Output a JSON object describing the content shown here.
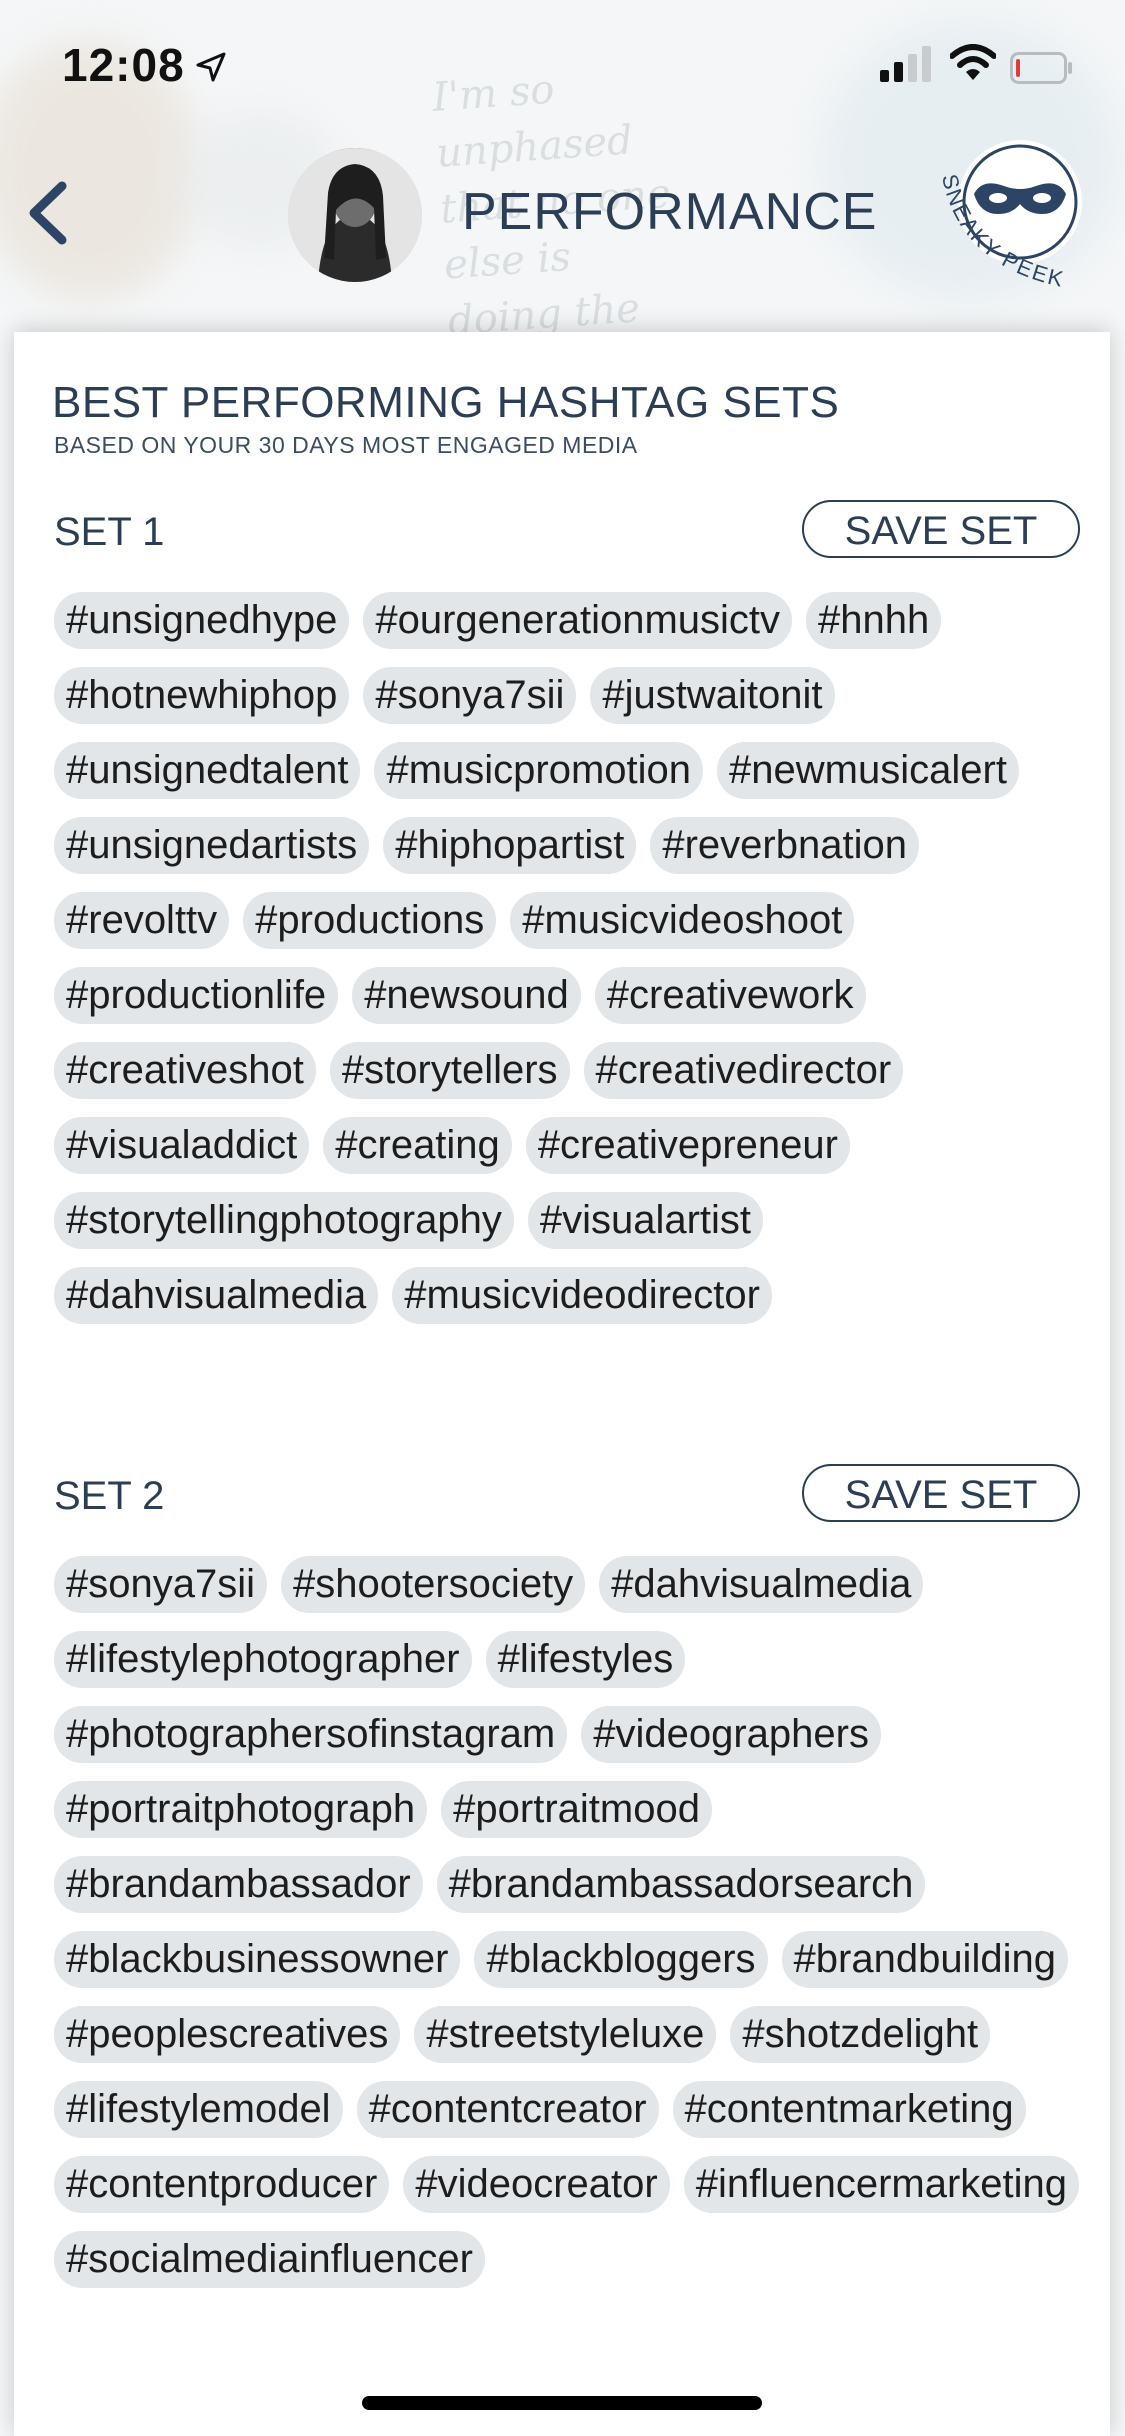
{
  "status_bar": {
    "time": "12:08"
  },
  "header": {
    "title": "PERFORMANCE"
  },
  "card": {
    "title": "BEST PERFORMING HASHTAG SETS",
    "subtitle": "BASED ON YOUR 30 DAYS MOST ENGAGED MEDIA"
  },
  "sets": [
    {
      "label": "SET 1",
      "save_label": "SAVE SET",
      "tags": [
        "#unsignedhype",
        "#ourgenerationmusictv",
        "#hnhh",
        "#hotnewhiphop",
        "#sonya7sii",
        "#justwaitonit",
        "#unsignedtalent",
        "#musicpromotion",
        "#newmusicalert",
        "#unsignedartists",
        "#hiphopartist",
        "#reverbnation",
        "#revolttv",
        "#productions",
        "#musicvideoshoot",
        "#productionlife",
        "#newsound",
        "#creativework",
        "#creativeshot",
        "#storytellers",
        "#creativedirector",
        "#visualaddict",
        "#creating",
        "#creativepreneur",
        "#storytellingphotography",
        "#visualartist",
        "#dahvisualmedia",
        "#musicvideodirector"
      ]
    },
    {
      "label": "SET 2",
      "save_label": "SAVE SET",
      "tags": [
        "#sonya7sii",
        "#shootersociety",
        "#dahvisualmedia",
        "#lifestylephotographer",
        "#lifestyles",
        "#photographersofinstagram",
        "#videographers",
        "#portraitphotograph",
        "#portraitmood",
        "#brandambassador",
        "#brandambassadorsearch",
        "#blackbusinessowner",
        "#blackbloggers",
        "#brandbuilding",
        "#peoplescreatives",
        "#streetstyleluxe",
        "#shotzdelight",
        "#lifestylemodel",
        "#contentcreator",
        "#contentmarketing",
        "#contentproducer",
        "#videocreator",
        "#influencermarketing",
        "#socialmediainfluencer"
      ]
    }
  ],
  "icons": {
    "back": "chevron-left-icon",
    "location": "location-arrow-icon",
    "signal": "cellular-signal-icon",
    "wifi": "wifi-icon",
    "battery": "battery-low-icon",
    "sneaky_peek": "mask-badge-icon"
  },
  "colors": {
    "accent": "#2c3e56",
    "tag_bg": "#e2e6e8",
    "battery_low": "#e53935"
  }
}
